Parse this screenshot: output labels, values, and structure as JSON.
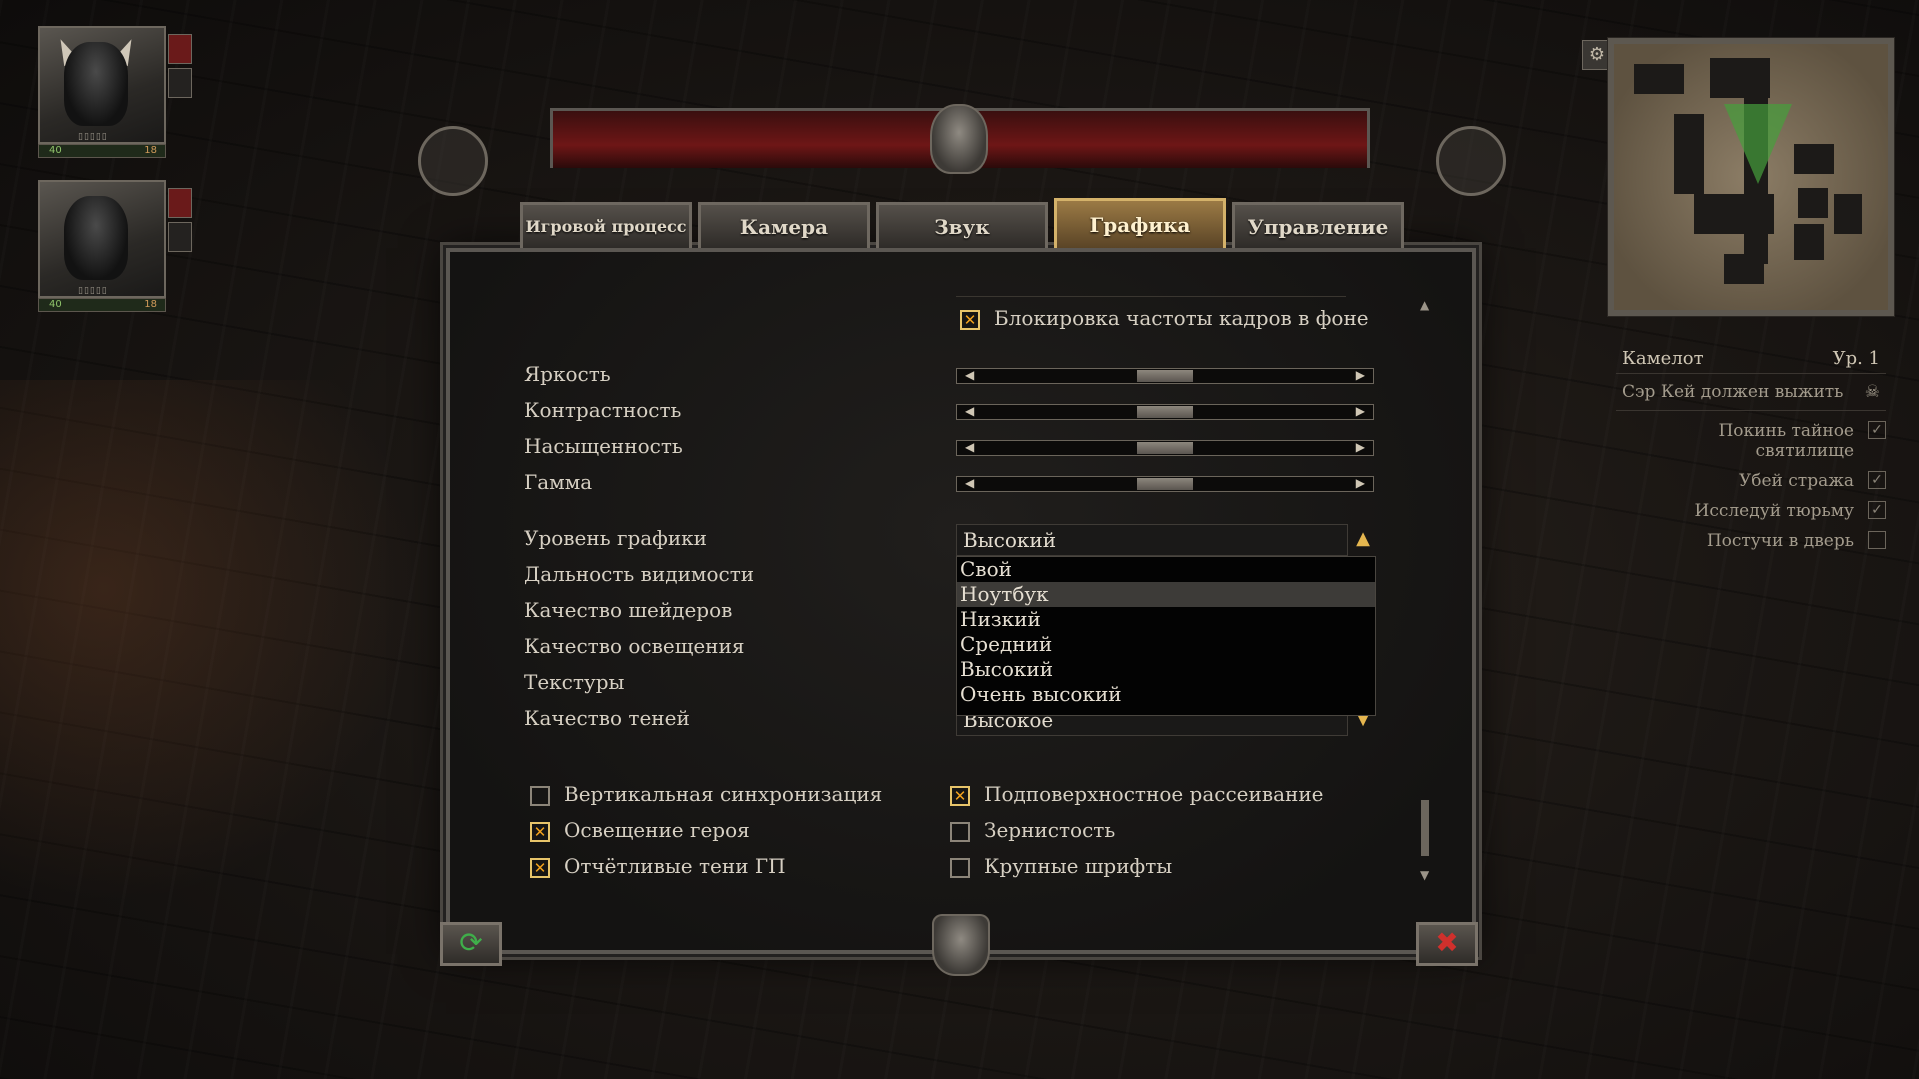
{
  "party": [
    {
      "hp": "40",
      "ap": "18",
      "pips": "▯▯▯▯▯"
    },
    {
      "hp": "40",
      "ap": "18",
      "pips": "▯▯▯▯▯"
    }
  ],
  "minimap": {
    "gear_icon": "⚙"
  },
  "quest": {
    "location": "Камелот",
    "level": "Ур. 1",
    "main": "Сэр Кей должен выжить",
    "main_icon": "☠",
    "items": [
      {
        "text": "Покинь тайное святилище",
        "done": "✓"
      },
      {
        "text": "Убей стража",
        "done": "✓"
      },
      {
        "text": "Исследуй тюрьму",
        "done": "✓"
      },
      {
        "text": "Постучи в дверь",
        "done": ""
      }
    ]
  },
  "tabs": [
    {
      "label": "Игровой процесс"
    },
    {
      "label": "Камера"
    },
    {
      "label": "Звук"
    },
    {
      "label": "Графика"
    },
    {
      "label": "Управление"
    }
  ],
  "active_tab": "Графика",
  "graphics": {
    "frame_lock": {
      "label": "Блокировка частоты кадров в фоне",
      "checked": "✕"
    },
    "sliders": {
      "brightness": {
        "label": "Яркость",
        "value": 0.5
      },
      "contrast": {
        "label": "Контрастность",
        "value": 0.5
      },
      "saturation": {
        "label": "Насыщенность",
        "value": 0.5
      },
      "gamma": {
        "label": "Гамма",
        "value": 0.5
      }
    },
    "quality_level": {
      "label": "Уровень графики",
      "value": "Высокий"
    },
    "draw_distance": {
      "label": "Дальность видимости"
    },
    "shader_quality": {
      "label": "Качество шейдеров"
    },
    "lighting_quality": {
      "label": "Качество освещения"
    },
    "textures": {
      "label": "Текстуры"
    },
    "shadow_quality": {
      "label": "Качество теней",
      "value": "Высокое"
    },
    "dropdown_options": [
      "Свой",
      "Ноутбук",
      "Низкий",
      "Средний",
      "Высокий",
      "Очень высокий"
    ],
    "dropdown_highlighted": "Ноутбук",
    "checkboxes": {
      "vsync": {
        "label": "Вертикальная синхронизация",
        "mark": ""
      },
      "hero_light": {
        "label": "Освещение героя",
        "mark": "✕"
      },
      "sharp_shadows": {
        "label": "Отчётливые тени ГП",
        "mark": "✕"
      },
      "subsurface": {
        "label": "Подповерхностное рассеивание",
        "mark": "✕"
      },
      "grain": {
        "label": "Зернистость",
        "mark": ""
      },
      "large_fonts": {
        "label": "Крупные шрифты",
        "mark": ""
      }
    }
  },
  "buttons": {
    "reset_icon": "⟳",
    "close_icon": "✖"
  },
  "colors": {
    "accent": "#f3a21d",
    "tab_active": "#d4b26a",
    "reset": "#3fae4a",
    "close": "#d0302c"
  }
}
